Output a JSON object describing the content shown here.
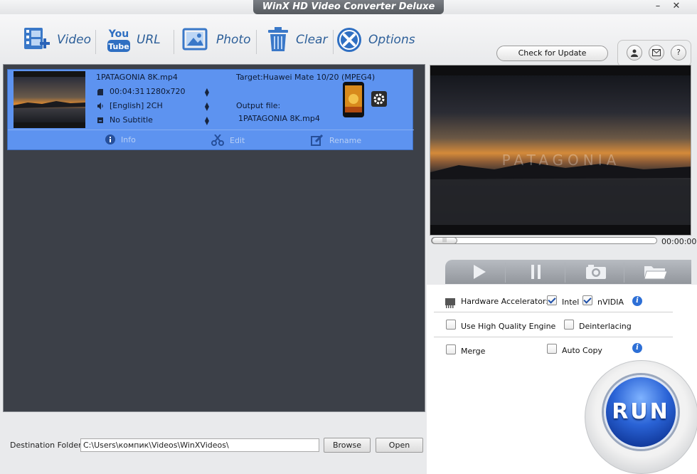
{
  "window": {
    "title": "WinX HD Video Converter Deluxe"
  },
  "toolbar": {
    "video": "Video",
    "url": "URL",
    "photo": "Photo",
    "clear": "Clear",
    "options": "Options",
    "youtube_top": "You",
    "youtube_bottom": "Tube",
    "check_update": "Check for Update",
    "help": "?"
  },
  "file_item": {
    "filename": "1PATAGONIA 8K.mp4",
    "duration": "00:04:31",
    "resolution": "1280x720",
    "audio": "[English] 2CH",
    "subtitle": "No Subtitle",
    "target": "Target:Huawei Mate 10/20 (MPEG4)",
    "output_label": "Output file:",
    "output_file": "1PATAGONIA 8K.mp4",
    "actions": {
      "info": "Info",
      "edit": "Edit",
      "rename": "Rename"
    }
  },
  "destination": {
    "label": "Destination Folder:",
    "path": "C:\\Users\\компик\\Videos\\WinXVideos\\",
    "browse": "Browse",
    "open": "Open"
  },
  "preview": {
    "watermark": "PATAGONIA",
    "time": "00:00:00",
    "progress": 0
  },
  "options": {
    "hw_label": "Hardware Accelerator:",
    "intel": "Intel",
    "intel_checked": true,
    "nvidia": "nVIDIA",
    "nvidia_checked": true,
    "hq_engine": "Use High Quality Engine",
    "hq_checked": false,
    "deinterlacing": "Deinterlacing",
    "deinterlacing_checked": false,
    "merge": "Merge",
    "merge_checked": false,
    "auto_copy": "Auto Copy",
    "auto_copy_checked": false,
    "info_glyph": "i"
  },
  "run": {
    "label": "RUN"
  },
  "colors": {
    "accent": "#2d5f99",
    "item_bg": "#5d93f0",
    "list_bg": "#3c4048",
    "run_blue": "#2a63d6"
  }
}
